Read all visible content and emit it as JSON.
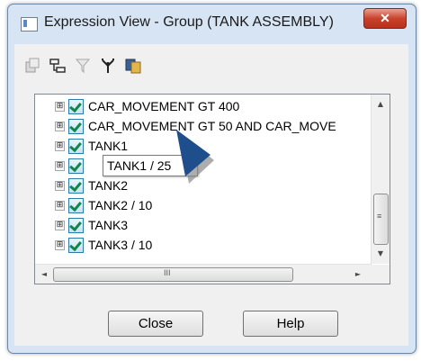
{
  "window": {
    "title": "Expression View - Group (TANK ASSEMBLY)",
    "close_glyph": "✕"
  },
  "toolbar": {
    "icons": [
      "properties-icon",
      "hierarchy-icon",
      "filter-icon",
      "tree-icon",
      "copy-icon"
    ]
  },
  "tree": {
    "rows": [
      {
        "expander": "⊞",
        "checked": true,
        "label": "CAR_MOVEMENT GT 400"
      },
      {
        "expander": "⊞",
        "checked": true,
        "label": "CAR_MOVEMENT GT 50 AND CAR_MOVE"
      },
      {
        "expander": "⊞",
        "checked": true,
        "label": "TANK1"
      },
      {
        "expander": "⊞",
        "checked": true,
        "label": "TANK1 / 25"
      },
      {
        "expander": "⊞",
        "checked": true,
        "label": "TANK2"
      },
      {
        "expander": "⊞",
        "checked": true,
        "label": "TANK2 / 10"
      },
      {
        "expander": "⊞",
        "checked": true,
        "label": "TANK3"
      },
      {
        "expander": "⊞",
        "checked": true,
        "label": "TANK3 / 10"
      }
    ],
    "editing_row_index": 3,
    "vscroll_up": "▲",
    "vscroll_down": "▼",
    "hscroll_left": "◄",
    "hscroll_right": "►",
    "hthumb_grip": "III"
  },
  "buttons": {
    "close": "Close",
    "help": "Help"
  },
  "colors": {
    "titlebar": "#d6e4f3",
    "close_button": "#c9432c",
    "checkmark": "#12864a",
    "pointer": "#1f4e8c"
  }
}
